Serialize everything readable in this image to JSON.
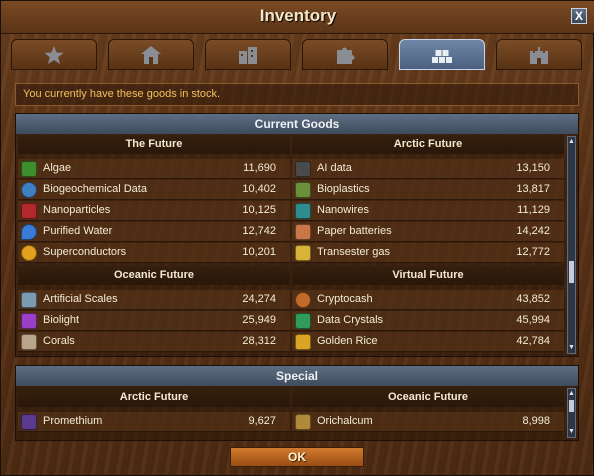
{
  "window": {
    "title": "Inventory",
    "close_label": "X"
  },
  "tabs": [
    {
      "icon": "star-icon",
      "active": false
    },
    {
      "icon": "house-icon",
      "active": false
    },
    {
      "icon": "buildings-icon",
      "active": false
    },
    {
      "icon": "puzzle-icon",
      "active": false
    },
    {
      "icon": "goods-bricks-icon",
      "active": true
    },
    {
      "icon": "castle-icon",
      "active": false
    }
  ],
  "info": "You currently have these goods in stock.",
  "current_goods": {
    "header": "Current Goods",
    "groups": [
      {
        "title": "The Future",
        "items": [
          {
            "name": "Algae",
            "qty": "11,690",
            "icon": "algae-icon",
            "color": "#3e8f2c"
          },
          {
            "name": "Biogeochemical Data",
            "qty": "10,402",
            "icon": "globe-icon",
            "color": "#3f7fc2"
          },
          {
            "name": "Nanoparticles",
            "qty": "10,125",
            "icon": "nanoparticles-icon",
            "color": "#b3282a"
          },
          {
            "name": "Purified Water",
            "qty": "12,742",
            "icon": "water-drop-icon",
            "color": "#3a7bd5"
          },
          {
            "name": "Superconductors",
            "qty": "10,201",
            "icon": "superconductor-icon",
            "color": "#e3a21e"
          }
        ]
      },
      {
        "title": "Arctic Future",
        "items": [
          {
            "name": "AI data",
            "qty": "13,150",
            "icon": "ai-data-icon",
            "color": "#4a4a4a"
          },
          {
            "name": "Bioplastics",
            "qty": "13,817",
            "icon": "recycle-icon",
            "color": "#6b8f3a"
          },
          {
            "name": "Nanowires",
            "qty": "11,129",
            "icon": "nanowires-icon",
            "color": "#2f8c8c"
          },
          {
            "name": "Paper batteries",
            "qty": "14,242",
            "icon": "paper-battery-icon",
            "color": "#c9764a"
          },
          {
            "name": "Transester gas",
            "qty": "12,772",
            "icon": "gas-icon",
            "color": "#d7b33a"
          }
        ]
      },
      {
        "title": "Oceanic Future",
        "items": [
          {
            "name": "Artificial Scales",
            "qty": "24,274",
            "icon": "scales-icon",
            "color": "#7a9bb0"
          },
          {
            "name": "Biolight",
            "qty": "25,949",
            "icon": "biolight-icon",
            "color": "#9b3fc9"
          },
          {
            "name": "Corals",
            "qty": "28,312",
            "icon": "coral-icon",
            "color": "#b8a58a"
          }
        ]
      },
      {
        "title": "Virtual Future",
        "items": [
          {
            "name": "Cryptocash",
            "qty": "43,852",
            "icon": "cryptocash-icon",
            "color": "#c06a2b"
          },
          {
            "name": "Data Crystals",
            "qty": "45,994",
            "icon": "data-crystal-icon",
            "color": "#2f9a5a"
          },
          {
            "name": "Golden Rice",
            "qty": "42,784",
            "icon": "golden-rice-icon",
            "color": "#d9a524"
          }
        ]
      }
    ]
  },
  "special": {
    "header": "Special",
    "groups": [
      {
        "title": "Arctic Future",
        "items": [
          {
            "name": "Promethium",
            "qty": "9,627",
            "icon": "promethium-icon",
            "color": "#5a3a8c"
          }
        ]
      },
      {
        "title": "Oceanic Future",
        "items": [
          {
            "name": "Orichalcum",
            "qty": "8,998",
            "icon": "orichalcum-icon",
            "color": "#b08a3a"
          }
        ]
      }
    ]
  },
  "ok_label": "OK"
}
